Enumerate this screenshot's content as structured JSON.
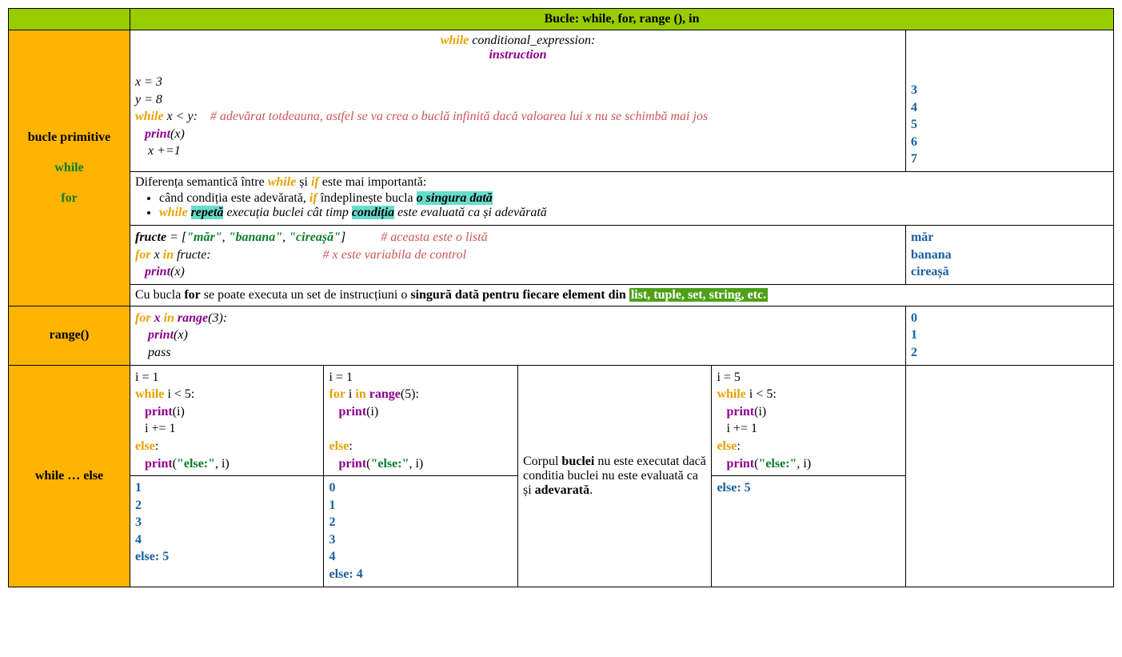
{
  "title": "Bucle: while, for, range (), in",
  "sidebar": {
    "bucle_primitive": "bucle primitive",
    "while": "while",
    "for": "for",
    "range": "range()",
    "while_else": "while … else"
  },
  "row1": {
    "syntax_while": "while",
    "syntax_cond": " conditional_expression:",
    "syntax_instr": "instruction",
    "code": {
      "l1": "x = 3",
      "l2": "y = 8",
      "l3_kw": "while",
      "l3_rest": " x < y:    ",
      "l3_cmt": "# adevărat totdeauna, astfel se va crea o buclă infinită dacă valoarea lui x nu se schimbă mai jos",
      "l4_fn": "print",
      "l4_rest": "(x)",
      "l5": "    x +=1"
    },
    "output": "3\n4\n5\n6\n7"
  },
  "row2": {
    "p1_a": "Diferența semantică între ",
    "p1_while": "while",
    "p1_b": " și ",
    "p1_if": "if",
    "p1_c": " este mai importantă:",
    "li1_a": "când condiția este adevărată, ",
    "li1_if": "if",
    "li1_b": " îndeplinește bucla ",
    "li1_hl": "o singura dată",
    "li2_while": "while",
    "li2_sp": " ",
    "li2_hl1": "repetă",
    "li2_b": " execuția buclei cât timp ",
    "li2_hl2": "condiția",
    "li2_c": " este evaluată ca și adevărată"
  },
  "row3": {
    "code": {
      "l1_a": "fructe",
      "l1_b": " = [",
      "l1_s1": "\"măr\"",
      "l1_c": ", ",
      "l1_s2": "\"banana\"",
      "l1_d": ", ",
      "l1_s3": "\"cireașă\"",
      "l1_e": "]           ",
      "l1_cmt": "# aceasta este o listă",
      "l2_for": "for",
      "l2_a": " x ",
      "l2_in": "in",
      "l2_b": " fructe:                                   ",
      "l2_cmt": "# x este variabila de control",
      "l3_fn": "print",
      "l3_rest": "(x)"
    },
    "output": "măr\nbanana\ncireașă"
  },
  "row4": {
    "a": "Cu bucla ",
    "for": "for",
    "b": " se poate executa un set de instrucțiuni o ",
    "c": "singură dată pentru fiecare element din ",
    "hl": "list, tuple, set, string, etc."
  },
  "row5": {
    "code": {
      "l1_for": "for",
      "l1_sp": " ",
      "l1_x": "x",
      "l1_sp2": " ",
      "l1_in": "in",
      "l1_sp3": " ",
      "l1_range": "range",
      "l1_rest": "(3):",
      "l2_fn": "print",
      "l2_rest": "(x)",
      "l3": "    pass"
    },
    "output": "0\n1\n2"
  },
  "row6": {
    "col1_code": {
      "l1": "i = 1",
      "l2_kw": "while",
      "l2_rest": " i < 5:",
      "l3_fn": "print",
      "l3_rest": "(i)",
      "l4": "   i += 1",
      "l5_kw": "else",
      "l5_rest": ":",
      "l6_fn": "print",
      "l6_a": "(",
      "l6_str": "\"else:\"",
      "l6_b": ", i)"
    },
    "col1_out": "1\n2\n3\n4\nelse: 5",
    "col2_code": {
      "l1": "i = 1",
      "l2_for": "for",
      "l2_a": " i ",
      "l2_in": "in",
      "l2_sp": " ",
      "l2_range": "range",
      "l2_rest": "(5):",
      "l3_fn": "print",
      "l3_rest": "(i)",
      "blank": "",
      "l5_kw": "else",
      "l5_rest": ":",
      "l6_fn": "print",
      "l6_a": "(",
      "l6_str": "\"else:\"",
      "l6_b": ", i)"
    },
    "col2_out": "0\n1\n2\n3\n4\nelse: 4",
    "col3_a": "Corpul ",
    "col3_b": "buclei",
    "col3_c": " nu este executat dacă conditia buclei nu este evaluată ca și ",
    "col3_d": "adevarată",
    "col3_e": ".",
    "col4_code": {
      "l1": "i = 5",
      "l2_kw": "while",
      "l2_rest": " i < 5:",
      "l3_fn": "print",
      "l3_rest": "(i)",
      "l4": "   i += 1",
      "l5_kw": "else",
      "l5_rest": ":",
      "l6_fn": "print",
      "l6_a": "(",
      "l6_str": "\"else:\"",
      "l6_b": ", i)"
    },
    "col4_out": "else: 5"
  }
}
